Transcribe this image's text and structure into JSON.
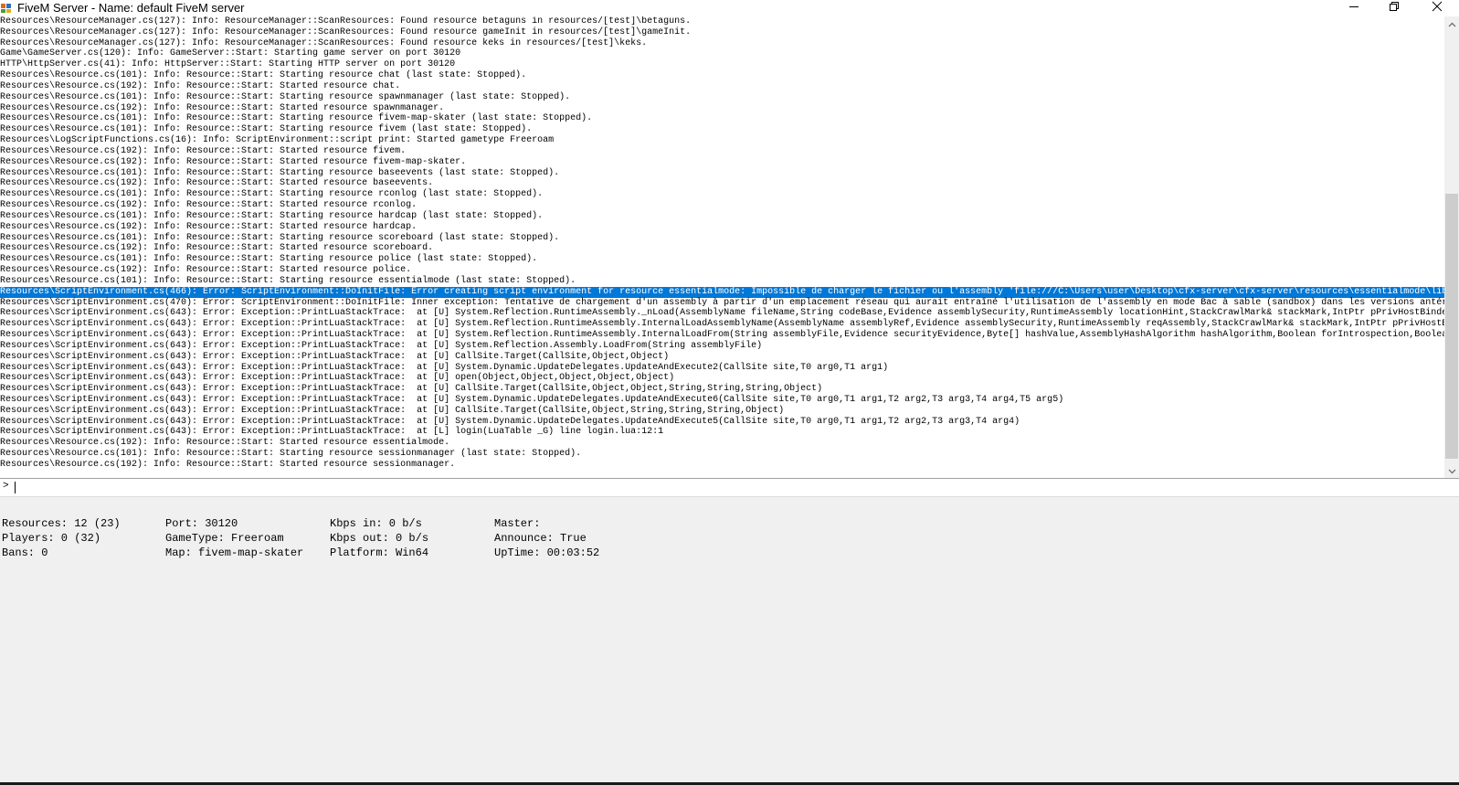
{
  "window": {
    "title": "FiveM Server - Name: default FiveM server",
    "icon": "fivem-app-icon",
    "controls": [
      "minimize-icon",
      "restore-icon",
      "close-icon"
    ]
  },
  "console": {
    "lines": [
      "Resources\\ResourceManager.cs(127): Info: ResourceManager::ScanResources: Found resource betaguns in resources/[test]\\betaguns.",
      "Resources\\ResourceManager.cs(127): Info: ResourceManager::ScanResources: Found resource gameInit in resources/[test]\\gameInit.",
      "Resources\\ResourceManager.cs(127): Info: ResourceManager::ScanResources: Found resource keks in resources/[test]\\keks.",
      "Game\\GameServer.cs(120): Info: GameServer::Start: Starting game server on port 30120",
      "HTTP\\HttpServer.cs(41): Info: HttpServer::Start: Starting HTTP server on port 30120",
      "Resources\\Resource.cs(101): Info: Resource::Start: Starting resource chat (last state: Stopped).",
      "Resources\\Resource.cs(192): Info: Resource::Start: Started resource chat.",
      "Resources\\Resource.cs(101): Info: Resource::Start: Starting resource spawnmanager (last state: Stopped).",
      "Resources\\Resource.cs(192): Info: Resource::Start: Started resource spawnmanager.",
      "Resources\\Resource.cs(101): Info: Resource::Start: Starting resource fivem-map-skater (last state: Stopped).",
      "Resources\\Resource.cs(101): Info: Resource::Start: Starting resource fivem (last state: Stopped).",
      "Resources\\LogScriptFunctions.cs(16): Info: ScriptEnvironment::script print: Started gametype Freeroam",
      "Resources\\Resource.cs(192): Info: Resource::Start: Started resource fivem.",
      "Resources\\Resource.cs(192): Info: Resource::Start: Started resource fivem-map-skater.",
      "Resources\\Resource.cs(101): Info: Resource::Start: Starting resource baseevents (last state: Stopped).",
      "Resources\\Resource.cs(192): Info: Resource::Start: Started resource baseevents.",
      "Resources\\Resource.cs(101): Info: Resource::Start: Starting resource rconlog (last state: Stopped).",
      "Resources\\Resource.cs(192): Info: Resource::Start: Started resource rconlog.",
      "Resources\\Resource.cs(101): Info: Resource::Start: Starting resource hardcap (last state: Stopped).",
      "Resources\\Resource.cs(192): Info: Resource::Start: Started resource hardcap.",
      "Resources\\Resource.cs(101): Info: Resource::Start: Starting resource scoreboard (last state: Stopped).",
      "Resources\\Resource.cs(192): Info: Resource::Start: Started resource scoreboard.",
      "Resources\\Resource.cs(101): Info: Resource::Start: Starting resource police (last state: Stopped).",
      "Resources\\Resource.cs(192): Info: Resource::Start: Started resource police.",
      "Resources\\Resource.cs(101): Info: Resource::Start: Starting resource essentialmode (last state: Stopped).",
      "Resources\\ScriptEnvironment.cs(466): Error: ScriptEnvironment::DoInitFile: Error creating script environment for resource essentialmode: Impossible de charger le fichier ou l'assembly 'file:///C:\\Users\\user\\Desktop\\cfx-server\\cfx-server\\resources\\essentialmode\\lib",
      "Resources\\ScriptEnvironment.cs(470): Error: ScriptEnvironment::DoInitFile: Inner exception: Tentative de chargement d'un assembly à partir d'un emplacement réseau qui aurait entraîné l'utilisation de l'assembly en mode Bac à sable (sandbox) dans les versions antér",
      "Resources\\ScriptEnvironment.cs(643): Error: Exception::PrintLuaStackTrace:  at [U] System.Reflection.RuntimeAssembly._nLoad(AssemblyName fileName,String codeBase,Evidence assemblySecurity,RuntimeAssembly locationHint,StackCrawlMark& stackMark,IntPtr pPrivHostBinde",
      "Resources\\ScriptEnvironment.cs(643): Error: Exception::PrintLuaStackTrace:  at [U] System.Reflection.RuntimeAssembly.InternalLoadAssemblyName(AssemblyName assemblyRef,Evidence assemblySecurity,RuntimeAssembly reqAssembly,StackCrawlMark& stackMark,IntPtr pPrivHostB",
      "Resources\\ScriptEnvironment.cs(643): Error: Exception::PrintLuaStackTrace:  at [U] System.Reflection.RuntimeAssembly.InternalLoadFrom(String assemblyFile,Evidence securityEvidence,Byte[] hashValue,AssemblyHashAlgorithm hashAlgorithm,Boolean forIntrospection,Boolea",
      "Resources\\ScriptEnvironment.cs(643): Error: Exception::PrintLuaStackTrace:  at [U] System.Reflection.Assembly.LoadFrom(String assemblyFile)",
      "Resources\\ScriptEnvironment.cs(643): Error: Exception::PrintLuaStackTrace:  at [U] CallSite.Target(CallSite,Object,Object)",
      "Resources\\ScriptEnvironment.cs(643): Error: Exception::PrintLuaStackTrace:  at [U] System.Dynamic.UpdateDelegates.UpdateAndExecute2(CallSite site,T0 arg0,T1 arg1)",
      "Resources\\ScriptEnvironment.cs(643): Error: Exception::PrintLuaStackTrace:  at [U] open(Object,Object,Object,Object,Object)",
      "Resources\\ScriptEnvironment.cs(643): Error: Exception::PrintLuaStackTrace:  at [U] CallSite.Target(CallSite,Object,Object,String,String,String,Object)",
      "Resources\\ScriptEnvironment.cs(643): Error: Exception::PrintLuaStackTrace:  at [U] System.Dynamic.UpdateDelegates.UpdateAndExecute6(CallSite site,T0 arg0,T1 arg1,T2 arg2,T3 arg3,T4 arg4,T5 arg5)",
      "Resources\\ScriptEnvironment.cs(643): Error: Exception::PrintLuaStackTrace:  at [U] CallSite.Target(CallSite,Object,String,String,String,Object)",
      "Resources\\ScriptEnvironment.cs(643): Error: Exception::PrintLuaStackTrace:  at [U] System.Dynamic.UpdateDelegates.UpdateAndExecute5(CallSite site,T0 arg0,T1 arg1,T2 arg2,T3 arg3,T4 arg4)",
      "Resources\\ScriptEnvironment.cs(643): Error: Exception::PrintLuaStackTrace:  at [L] login(LuaTable _G) line login.lua:12:1",
      "Resources\\Resource.cs(192): Info: Resource::Start: Started resource essentialmode.",
      "Resources\\Resource.cs(101): Info: Resource::Start: Starting resource sessionmanager (last state: Stopped).",
      "Resources\\Resource.cs(192): Info: Resource::Start: Started resource sessionmanager."
    ],
    "selected_index": 25,
    "selection_color": "#0078d7"
  },
  "command": {
    "prompt": ">",
    "value": ""
  },
  "status": {
    "col1": [
      "Resources: 12 (23)",
      "Players: 0 (32)",
      "Bans: 0"
    ],
    "col2": [
      "Port: 30120",
      "GameType: Freeroam",
      "Map: fivem-map-skater"
    ],
    "col3": [
      "Kbps in: 0 b/s",
      "Kbps out: 0 b/s",
      "Platform: Win64"
    ],
    "col4": [
      "Master:",
      "Announce: True",
      "UpTime: 00:03:52"
    ]
  }
}
